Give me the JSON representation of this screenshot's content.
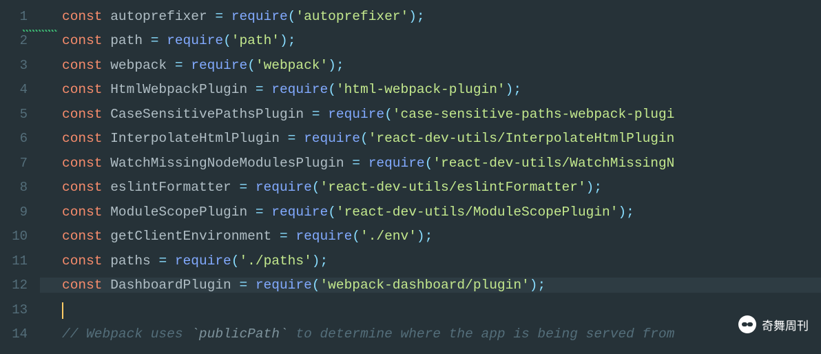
{
  "editor": {
    "lines": [
      {
        "n": "1",
        "tokens": [
          [
            "kw",
            "const"
          ],
          [
            "id",
            " autoprefixer "
          ],
          [
            "pun",
            "="
          ],
          [
            "id",
            " "
          ],
          [
            "fn",
            "require"
          ],
          [
            "pun",
            "("
          ],
          [
            "str",
            "'autoprefixer'"
          ],
          [
            "pun",
            ")"
          ],
          [
            "pun",
            ";"
          ]
        ]
      },
      {
        "n": "2",
        "tokens": [
          [
            "kw",
            "const"
          ],
          [
            "id",
            " path "
          ],
          [
            "pun",
            "="
          ],
          [
            "id",
            " "
          ],
          [
            "fn",
            "require"
          ],
          [
            "pun",
            "("
          ],
          [
            "str",
            "'path'"
          ],
          [
            "pun",
            ")"
          ],
          [
            "pun",
            ";"
          ]
        ]
      },
      {
        "n": "3",
        "tokens": [
          [
            "kw",
            "const"
          ],
          [
            "id",
            " webpack "
          ],
          [
            "pun",
            "="
          ],
          [
            "id",
            " "
          ],
          [
            "fn",
            "require"
          ],
          [
            "pun",
            "("
          ],
          [
            "str",
            "'webpack'"
          ],
          [
            "pun",
            ")"
          ],
          [
            "pun",
            ";"
          ]
        ]
      },
      {
        "n": "4",
        "tokens": [
          [
            "kw",
            "const"
          ],
          [
            "id",
            " HtmlWebpackPlugin "
          ],
          [
            "pun",
            "="
          ],
          [
            "id",
            " "
          ],
          [
            "fn",
            "require"
          ],
          [
            "pun",
            "("
          ],
          [
            "str",
            "'html-webpack-plugin'"
          ],
          [
            "pun",
            ")"
          ],
          [
            "pun",
            ";"
          ]
        ]
      },
      {
        "n": "5",
        "tokens": [
          [
            "kw",
            "const"
          ],
          [
            "id",
            " CaseSensitivePathsPlugin "
          ],
          [
            "pun",
            "="
          ],
          [
            "id",
            " "
          ],
          [
            "fn",
            "require"
          ],
          [
            "pun",
            "("
          ],
          [
            "str",
            "'case-sensitive-paths-webpack-plugi"
          ]
        ]
      },
      {
        "n": "6",
        "tokens": [
          [
            "kw",
            "const"
          ],
          [
            "id",
            " InterpolateHtmlPlugin "
          ],
          [
            "pun",
            "="
          ],
          [
            "id",
            " "
          ],
          [
            "fn",
            "require"
          ],
          [
            "pun",
            "("
          ],
          [
            "str",
            "'react-dev-utils/InterpolateHtmlPlugin"
          ]
        ]
      },
      {
        "n": "7",
        "tokens": [
          [
            "kw",
            "const"
          ],
          [
            "id",
            " WatchMissingNodeModulesPlugin "
          ],
          [
            "pun",
            "="
          ],
          [
            "id",
            " "
          ],
          [
            "fn",
            "require"
          ],
          [
            "pun",
            "("
          ],
          [
            "str",
            "'react-dev-utils/WatchMissingN"
          ]
        ]
      },
      {
        "n": "8",
        "tokens": [
          [
            "kw",
            "const"
          ],
          [
            "id",
            " eslintFormatter "
          ],
          [
            "pun",
            "="
          ],
          [
            "id",
            " "
          ],
          [
            "fn",
            "require"
          ],
          [
            "pun",
            "("
          ],
          [
            "str",
            "'react-dev-utils/eslintFormatter'"
          ],
          [
            "pun",
            ")"
          ],
          [
            "pun",
            ";"
          ]
        ]
      },
      {
        "n": "9",
        "tokens": [
          [
            "kw",
            "const"
          ],
          [
            "id",
            " ModuleScopePlugin "
          ],
          [
            "pun",
            "="
          ],
          [
            "id",
            " "
          ],
          [
            "fn",
            "require"
          ],
          [
            "pun",
            "("
          ],
          [
            "str",
            "'react-dev-utils/ModuleScopePlugin'"
          ],
          [
            "pun",
            ")"
          ],
          [
            "pun",
            ";"
          ]
        ]
      },
      {
        "n": "10",
        "tokens": [
          [
            "kw",
            "const"
          ],
          [
            "id",
            " getClientEnvironment "
          ],
          [
            "pun",
            "="
          ],
          [
            "id",
            " "
          ],
          [
            "fn",
            "require"
          ],
          [
            "pun",
            "("
          ],
          [
            "str",
            "'./env'"
          ],
          [
            "pun",
            ")"
          ],
          [
            "pun",
            ";"
          ]
        ]
      },
      {
        "n": "11",
        "tokens": [
          [
            "kw",
            "const"
          ],
          [
            "id",
            " paths "
          ],
          [
            "pun",
            "="
          ],
          [
            "id",
            " "
          ],
          [
            "fn",
            "require"
          ],
          [
            "pun",
            "("
          ],
          [
            "str",
            "'./paths'"
          ],
          [
            "pun",
            ")"
          ],
          [
            "pun",
            ";"
          ]
        ]
      },
      {
        "n": "12",
        "highlight": true,
        "tokens": [
          [
            "kw",
            "const"
          ],
          [
            "id",
            " DashboardPlugin "
          ],
          [
            "pun",
            "="
          ],
          [
            "id",
            " "
          ],
          [
            "fn",
            "require"
          ],
          [
            "pun",
            "("
          ],
          [
            "str",
            "'webpack-dashboard/plugin'"
          ],
          [
            "pun",
            ")"
          ],
          [
            "pun",
            ";"
          ]
        ]
      },
      {
        "n": "13",
        "caret": true,
        "tokens": []
      },
      {
        "n": "14",
        "tokens": [
          [
            "cm",
            "// Webpack uses "
          ],
          [
            "cm-code",
            "`publicPath`"
          ],
          [
            "cm",
            " to determine where the app is being served from"
          ]
        ]
      }
    ]
  },
  "watermark": {
    "label": "奇舞周刊"
  }
}
